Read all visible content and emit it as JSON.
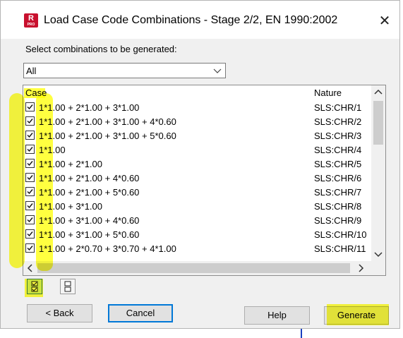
{
  "window": {
    "title": "Load Case Code Combinations - Stage 2/2, EN 1990:2002",
    "app_icon": {
      "letter": "R",
      "sub": "PRO"
    },
    "close_icon": "close-icon"
  },
  "prompt": "Select combinations to be generated:",
  "filter": {
    "selected": "All"
  },
  "list": {
    "columns": {
      "case": "Case",
      "nature": "Nature"
    },
    "rows": [
      {
        "case": "1*1.00 + 2*1.00 + 3*1.00",
        "nature": "SLS:CHR/1",
        "checked": true
      },
      {
        "case": "1*1.00 + 2*1.00 + 3*1.00 + 4*0.60",
        "nature": "SLS:CHR/2",
        "checked": true
      },
      {
        "case": "1*1.00 + 2*1.00 + 3*1.00 + 5*0.60",
        "nature": "SLS:CHR/3",
        "checked": true
      },
      {
        "case": "1*1.00",
        "nature": "SLS:CHR/4",
        "checked": true
      },
      {
        "case": "1*1.00 + 2*1.00",
        "nature": "SLS:CHR/5",
        "checked": true
      },
      {
        "case": "1*1.00 + 2*1.00 + 4*0.60",
        "nature": "SLS:CHR/6",
        "checked": true
      },
      {
        "case": "1*1.00 + 2*1.00 + 5*0.60",
        "nature": "SLS:CHR/7",
        "checked": true
      },
      {
        "case": "1*1.00 + 3*1.00",
        "nature": "SLS:CHR/8",
        "checked": true
      },
      {
        "case": "1*1.00 + 3*1.00 + 4*0.60",
        "nature": "SLS:CHR/9",
        "checked": true
      },
      {
        "case": "1*1.00 + 3*1.00 + 5*0.60",
        "nature": "SLS:CHR/10",
        "checked": true
      },
      {
        "case": "1*1.00 + 2*0.70 + 3*0.70 + 4*1.00",
        "nature": "SLS:CHR/11",
        "checked": true
      }
    ]
  },
  "tools": {
    "check_all_icon": "check-all-icon",
    "uncheck_all_icon": "uncheck-all-icon"
  },
  "buttons": {
    "back": "< Back",
    "cancel": "Cancel",
    "help": "Help",
    "generate": "Generate"
  },
  "colors": {
    "highlight": "#ffff00",
    "focus": "#0078d7",
    "brand": "#c8102e"
  }
}
